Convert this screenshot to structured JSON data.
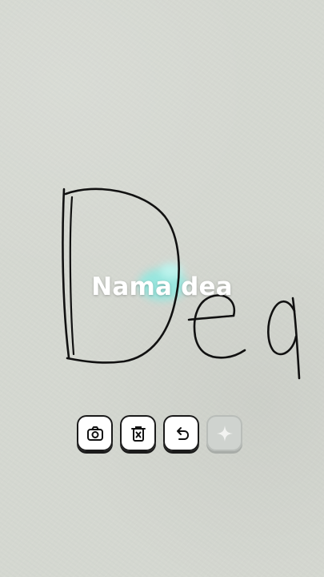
{
  "caption": {
    "text": "Nama dea"
  },
  "toolbar": {
    "buttons": [
      {
        "name": "camera-button",
        "icon": "camera-icon"
      },
      {
        "name": "clear-button",
        "icon": "trash-x-icon"
      },
      {
        "name": "undo-button",
        "icon": "undo-icon"
      },
      {
        "name": "magic-button",
        "icon": "sparkle-icon",
        "disabled": true
      }
    ]
  },
  "colors": {
    "paper": "#d5d8d1",
    "stroke": "#111111",
    "highlight": "#7ee6de",
    "button_bg": "#ffffff",
    "button_border": "#1b1b1b"
  }
}
